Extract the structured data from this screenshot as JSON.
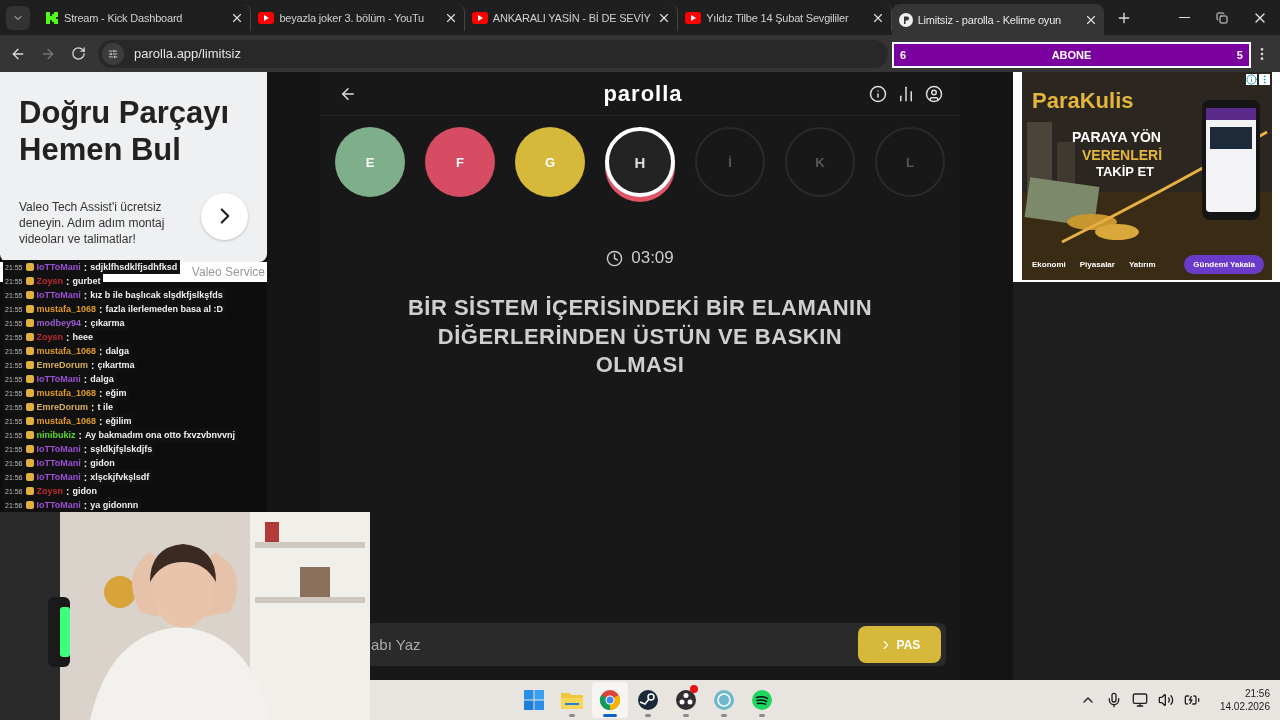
{
  "browser": {
    "tabs": [
      {
        "title": "Stream - Kick Dashboard",
        "kind": "kick",
        "selected": false
      },
      {
        "title": "beyazla joker 3. bölüm - YouTu",
        "kind": "youtube",
        "selected": false
      },
      {
        "title": "ANKARALI YASİN - Bİ DE SEVİY",
        "kind": "youtube",
        "selected": false
      },
      {
        "title": "Yıldız Tilbe 14 Şubat Sevgililer",
        "kind": "youtube",
        "selected": false
      },
      {
        "title": "Limitsiz - parolla - Kelime oyun",
        "kind": "parolla",
        "selected": true
      }
    ],
    "address": "parolla.app/limitsiz"
  },
  "subscriber_goal": {
    "current": "6",
    "label": "ABONE",
    "target": "5"
  },
  "left_ad": {
    "headline": "Doğru Parçayı Hemen Bul",
    "body": "Valeo Tech Assist'i ücretsiz deneyin. Adım adım montaj videoları ve talimatlar!",
    "footer": "Valeo Service"
  },
  "chat": [
    {
      "time": "21:55",
      "user": "IoTToMani",
      "color": "#9b4fd6",
      "separator": ":",
      "text": "sdjklfhsdklfjsdhfksd"
    },
    {
      "time": "21:55",
      "user": "Zoysn",
      "color": "#c0282f",
      "separator": ":",
      "text": "gurbet"
    },
    {
      "time": "21:55",
      "user": "IoTToMani",
      "color": "#9b4fd6",
      "separator": ":",
      "text": "kız b ile başlıcak slşdkfjslkşfds"
    },
    {
      "time": "21:55",
      "user": "mustafa_1068",
      "color": "#e09a2c",
      "separator": ":",
      "text": "fazla ilerlemeden basa al :D"
    },
    {
      "time": "21:55",
      "user": "modbey94",
      "color": "#9b59d0",
      "separator": ":",
      "text": "çıkarma"
    },
    {
      "time": "21:55",
      "user": "Zoysn",
      "color": "#c0282f",
      "separator": ":",
      "text": "heee"
    },
    {
      "time": "21:55",
      "user": "mustafa_1068",
      "color": "#e09a2c",
      "separator": ":",
      "text": "dalga"
    },
    {
      "time": "21:55",
      "user": "EmreDorum",
      "color": "#d8b060",
      "separator": ":",
      "text": "çıkartma"
    },
    {
      "time": "21:55",
      "user": "IoTToMani",
      "color": "#9b4fd6",
      "separator": ":",
      "text": "dalga"
    },
    {
      "time": "21:55",
      "user": "mustafa_1068",
      "color": "#e09a2c",
      "separator": ":",
      "text": "eğim"
    },
    {
      "time": "21:55",
      "user": "EmreDorum",
      "color": "#d8b060",
      "separator": ":",
      "text": "t ile"
    },
    {
      "time": "21:55",
      "user": "mustafa_1068",
      "color": "#e09a2c",
      "separator": ":",
      "text": "eğilim"
    },
    {
      "time": "21:55",
      "user": "ninibukiz",
      "color": "#5ad62a",
      "separator": ":",
      "text": "Ay bakmadım ona otto fxvzvbnvvnj"
    },
    {
      "time": "21:55",
      "user": "IoTToMani",
      "color": "#9b4fd6",
      "separator": ":",
      "text": "sşldkjfşlskdjfs"
    },
    {
      "time": "21:56",
      "user": "IoTToMani",
      "color": "#9b4fd6",
      "separator": ":",
      "text": "gidon"
    },
    {
      "time": "21:56",
      "user": "IoTToMani",
      "color": "#9b4fd6",
      "separator": ":",
      "text": "xlşckjfvkşlsdf"
    },
    {
      "time": "21:56",
      "user": "Zoysn",
      "color": "#c0282f",
      "separator": ":",
      "text": "gidon"
    },
    {
      "time": "21:56",
      "user": "IoTToMani",
      "color": "#9b4fd6",
      "separator": ":",
      "text": "ya gidonnn"
    }
  ],
  "game": {
    "title": "parolla",
    "letters": [
      {
        "letter": "E",
        "kind": "correct"
      },
      {
        "letter": "F",
        "kind": "wrong"
      },
      {
        "letter": "G",
        "kind": "passed"
      },
      {
        "letter": "H",
        "kind": "current"
      },
      {
        "letter": "İ",
        "kind": "pending"
      },
      {
        "letter": "K",
        "kind": "pending"
      },
      {
        "letter": "L",
        "kind": "pending"
      }
    ],
    "timer": "03:09",
    "question": "BİR SİSTEM İÇERİSİNDEKİ BİR ELAMANIN DİĞERLERİNDEN ÜSTÜN VE BASKIN OLMASI",
    "answer": {
      "placeholder": "abı Yaz"
    },
    "pass_button": "PAS"
  },
  "right_ad": {
    "brand": "ParaKulis",
    "headline": [
      "PARAYA YÖN",
      "VERENLERİ",
      "TAKİP ET"
    ],
    "categories": [
      "Ekonomi",
      "Piyasalar",
      "Yatırım"
    ],
    "button": "Gündemi Yakala"
  },
  "taskbar": {
    "apps": [
      {
        "kind": "start",
        "running": false,
        "active": false,
        "notification": false
      },
      {
        "kind": "files",
        "running": true,
        "active": false,
        "notification": false
      },
      {
        "kind": "chrome",
        "running": true,
        "active": true,
        "notification": false
      },
      {
        "kind": "steam",
        "running": true,
        "active": false,
        "notification": false
      },
      {
        "kind": "obs",
        "running": true,
        "active": false,
        "notification": true
      },
      {
        "kind": "bs",
        "running": true,
        "active": false,
        "notification": false
      },
      {
        "kind": "spotify",
        "running": true,
        "active": false,
        "notification": false
      }
    ],
    "time": "21:56",
    "date": "14.02.2026"
  }
}
